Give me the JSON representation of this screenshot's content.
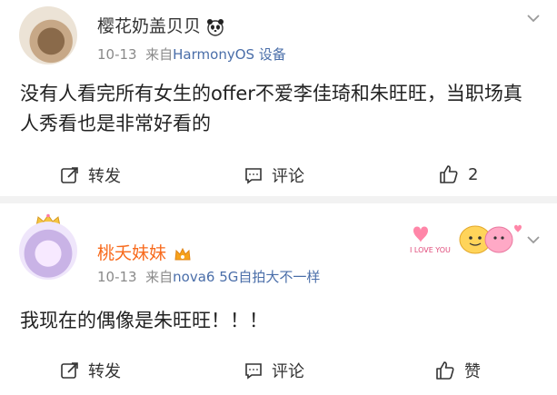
{
  "posts": [
    {
      "username": "樱花奶盖贝贝",
      "date": "10-13",
      "source_prefix": "来自",
      "device": "HarmonyOS 设备",
      "text": "没有人看完所有女生的offer不爱李佳琦和朱旺旺，当职场真人秀看也是非常好看的",
      "actions": {
        "repost": "转发",
        "comment": "评论",
        "like": "2"
      },
      "icons": [
        "panda-icon"
      ]
    },
    {
      "username": "桃夭妹妹",
      "date": "10-13",
      "source_prefix": "来自",
      "device": "nova6 5G自拍大不一样",
      "text": "我现在的偶像是朱旺旺！！！",
      "actions": {
        "repost": "转发",
        "comment": "评论",
        "like": "赞"
      },
      "icons": [
        "vip-crown-icon"
      ],
      "sticker_text": "I LOVE YOU"
    }
  ],
  "colors": {
    "username_vip": "#f86a1c",
    "device_link": "#4a6ea9",
    "meta_gray": "#8a8a8a",
    "separator": "#f2f2f2"
  }
}
